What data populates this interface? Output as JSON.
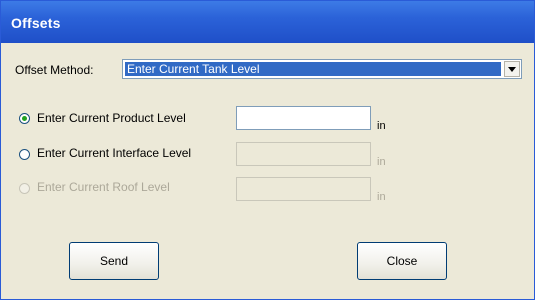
{
  "window": {
    "title": "Offsets"
  },
  "offset_method": {
    "label": "Offset Method:",
    "selected": "Enter Current Tank Level"
  },
  "options": [
    {
      "label": "Enter Current Product Level",
      "checked": true,
      "enabled": true,
      "unit": "in",
      "value": ""
    },
    {
      "label": "Enter Current Interface Level",
      "checked": false,
      "enabled": false,
      "unit": "in",
      "value": ""
    },
    {
      "label": "Enter Current Roof Level",
      "checked": false,
      "enabled": false,
      "unit": "in",
      "value": ""
    }
  ],
  "buttons": {
    "send": "Send",
    "close": "Close"
  },
  "icons": {
    "dropdown": "chevron-down-icon"
  }
}
